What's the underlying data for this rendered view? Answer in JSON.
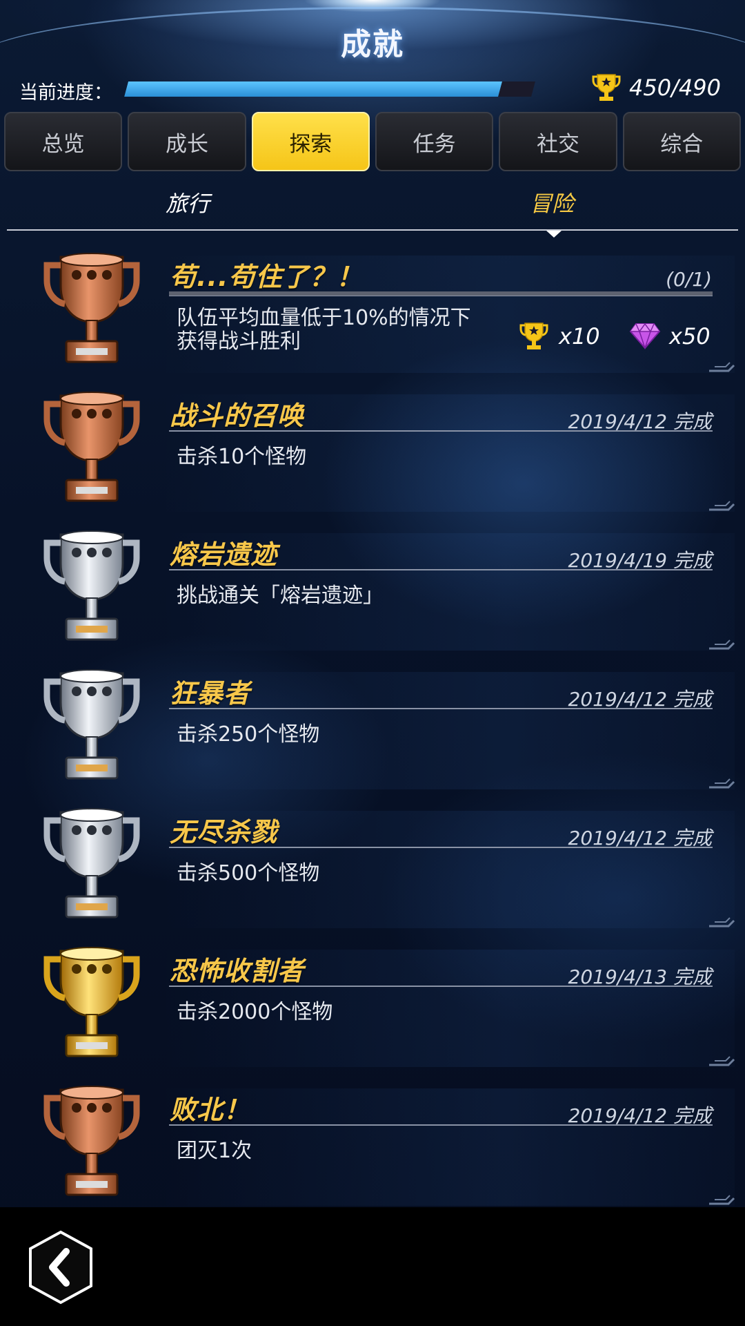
{
  "header": {
    "title": "成就"
  },
  "progress": {
    "label": "当前进度：",
    "fraction": 0.918,
    "trophy_count": "450/490"
  },
  "tabs": [
    {
      "label": "总览",
      "active": false
    },
    {
      "label": "成长",
      "active": false
    },
    {
      "label": "探索",
      "active": true
    },
    {
      "label": "任务",
      "active": false
    },
    {
      "label": "社交",
      "active": false
    },
    {
      "label": "综合",
      "active": false
    }
  ],
  "subtabs": {
    "travel": "旅行",
    "adventure": "冒险"
  },
  "achievements": [
    {
      "title": "苟...苟住了？！",
      "status": "(0/1)",
      "description_line1": "队伍平均血量低于10%的情况下",
      "description_line2": "获得战斗胜利",
      "trophy_tier": "bronze",
      "rewards": {
        "trophy_qty": "x10",
        "gem_qty": "x50"
      }
    },
    {
      "title": "战斗的召唤",
      "status": "2019/4/12  完成",
      "description_line1": "击杀10个怪物",
      "trophy_tier": "bronze"
    },
    {
      "title": "熔岩遗迹",
      "status": "2019/4/19  完成",
      "description_line1": "挑战通关「熔岩遗迹」",
      "trophy_tier": "silver"
    },
    {
      "title": "狂暴者",
      "status": "2019/4/12  完成",
      "description_line1": "击杀250个怪物",
      "trophy_tier": "silver"
    },
    {
      "title": "无尽杀戮",
      "status": "2019/4/12  完成",
      "description_line1": "击杀500个怪物",
      "trophy_tier": "silver"
    },
    {
      "title": "恐怖收割者",
      "status": "2019/4/13  完成",
      "description_line1": "击杀2000个怪物",
      "trophy_tier": "gold"
    },
    {
      "title": "败北！",
      "status": "2019/4/12  完成",
      "description_line1": "团灭1次",
      "trophy_tier": "bronze"
    }
  ],
  "icons": {
    "back": "chevron-left-icon",
    "trophy": "trophy-icon",
    "gem": "diamond-icon"
  },
  "colors": {
    "accent_yellow": "#f5c518",
    "title_gold": "#f7c74a",
    "progress_blue": "#3aa8ec",
    "gem_purple": "#c855e8"
  }
}
